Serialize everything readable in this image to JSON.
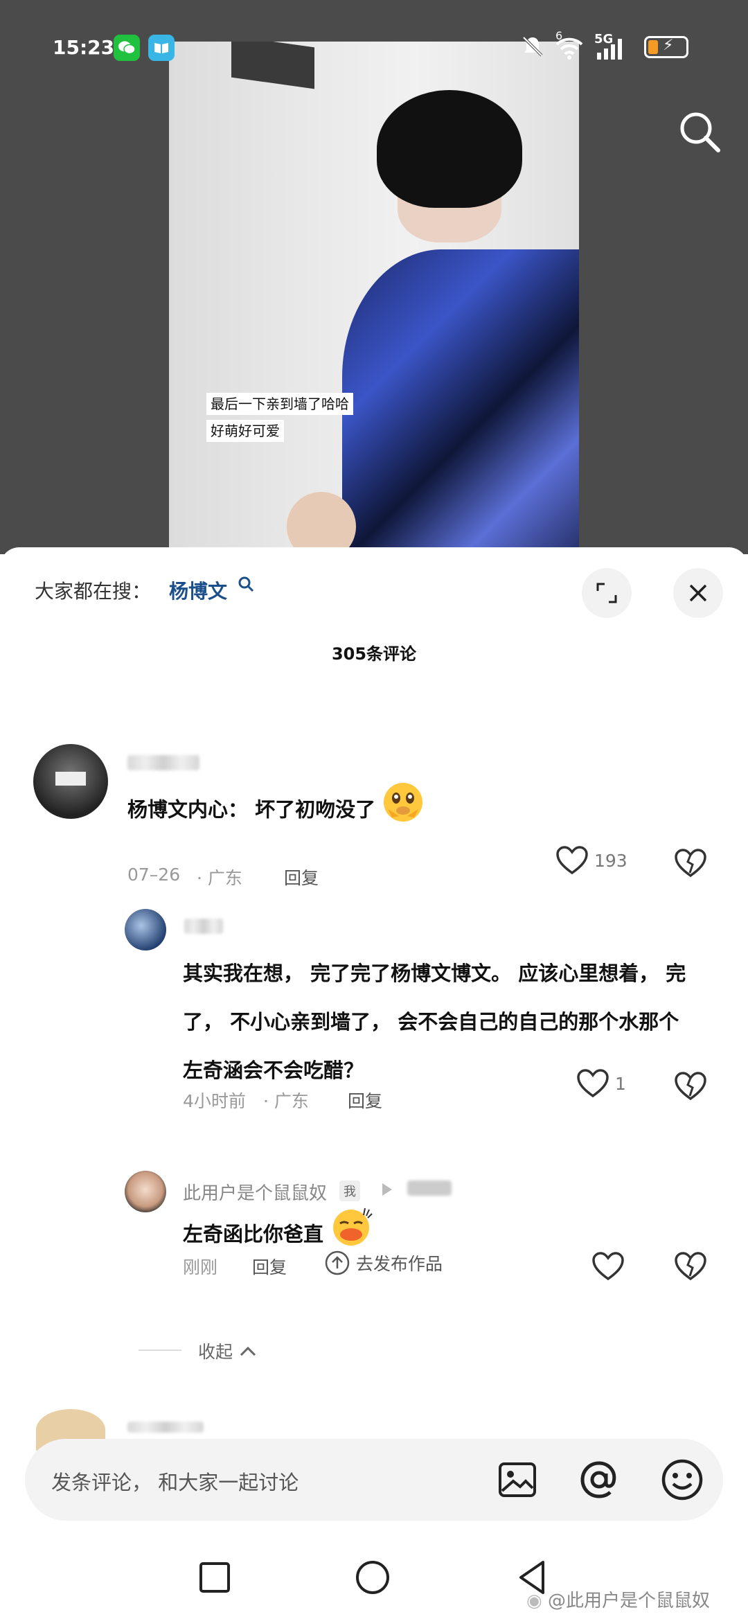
{
  "status_bar": {
    "time": "15:23",
    "network_label": "5G",
    "wifi_badge": "6"
  },
  "video": {
    "subtitle_line1": "最后一下亲到墙了哈哈",
    "subtitle_line2": "好萌好可爱"
  },
  "sheet": {
    "hot_search_label": "大家都在搜：",
    "hot_search_term": "杨博文",
    "comment_count_title": "305条评论"
  },
  "comments": [
    {
      "text": "杨博文内心： 坏了初吻没了",
      "emoji": "crying-pleading-emoji",
      "date": "07–26",
      "location": "· 广东",
      "reply_label": "回复",
      "likes": "193"
    }
  ],
  "replies": [
    {
      "text_line1": "其实我在想， 完了完了杨博文博文。 应该心里想着， 完",
      "text_line2": "了， 不小心亲到墙了， 会不会自己的自己的那个水那个",
      "text_line3": "左奇涵会不会吃醋？",
      "time": "4小时前",
      "location": "· 广东",
      "reply_label": "回复",
      "likes": "1"
    },
    {
      "username": "此用户是个鼠鼠奴",
      "me_tag": "我",
      "text": "左奇函比你爸直",
      "emoji": "duck-lips-emoji",
      "time": "刚刚",
      "reply_label": "回复",
      "publish_label": "去发布作品"
    }
  ],
  "collapse_label": "收起",
  "input": {
    "placeholder": "发条评论， 和大家一起讨论"
  },
  "watermark": "@此用户是个鼠鼠奴",
  "colors": {
    "accent_link": "#1b4f8c",
    "battery": "#f39b26"
  }
}
